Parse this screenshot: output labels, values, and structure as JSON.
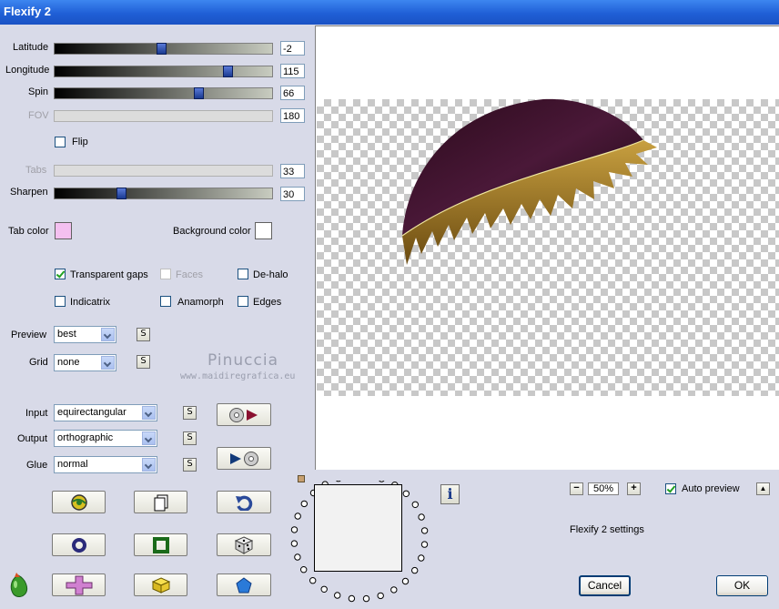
{
  "window": {
    "title": "Flexify 2"
  },
  "sliders": [
    {
      "label": "Latitude",
      "value": "-2",
      "fraction": 0.49,
      "enabled": true
    },
    {
      "label": "Longitude",
      "value": "115",
      "fraction": 0.81,
      "enabled": true
    },
    {
      "label": "Spin",
      "value": "66",
      "fraction": 0.67,
      "enabled": true
    },
    {
      "label": "FOV",
      "value": "180",
      "fraction": 0,
      "enabled": false
    },
    {
      "label": "Tabs",
      "value": "33",
      "fraction": 0,
      "enabled": false
    },
    {
      "label": "Sharpen",
      "value": "30",
      "fraction": 0.3,
      "enabled": true
    }
  ],
  "flip": {
    "label": "Flip",
    "checked": false
  },
  "colors": {
    "tab_label": "Tab color",
    "tab_value": "#f4c0f0",
    "bg_label": "Background color",
    "bg_value": "#ffffff"
  },
  "options": [
    {
      "label": "Transparent gaps",
      "checked": true,
      "enabled": true
    },
    {
      "label": "Faces",
      "checked": false,
      "enabled": false
    },
    {
      "label": "De-halo",
      "checked": false,
      "enabled": true
    },
    {
      "label": "Indicatrix",
      "checked": false,
      "enabled": true
    },
    {
      "label": "Anamorph",
      "checked": false,
      "enabled": true
    },
    {
      "label": "Edges",
      "checked": false,
      "enabled": true
    }
  ],
  "preview_select": {
    "label": "Preview",
    "value": "best"
  },
  "grid_select": {
    "label": "Grid",
    "value": "none"
  },
  "input_select": {
    "label": "Input",
    "value": "equirectangular"
  },
  "output_select": {
    "label": "Output",
    "value": "orthographic"
  },
  "glue_select": {
    "label": "Glue",
    "value": "normal"
  },
  "s_label": "S",
  "watermark": {
    "name": "Pinuccia",
    "url": "www.maidiregrafica.eu"
  },
  "zoom": {
    "value": "50%",
    "minus": "−",
    "plus": "+"
  },
  "auto_preview": {
    "label": "Auto preview",
    "checked": true
  },
  "caret_label": "▲",
  "settings_label": "Flexify 2 settings",
  "info_label": "i",
  "buttons": {
    "cancel": "Cancel",
    "ok": "OK"
  }
}
